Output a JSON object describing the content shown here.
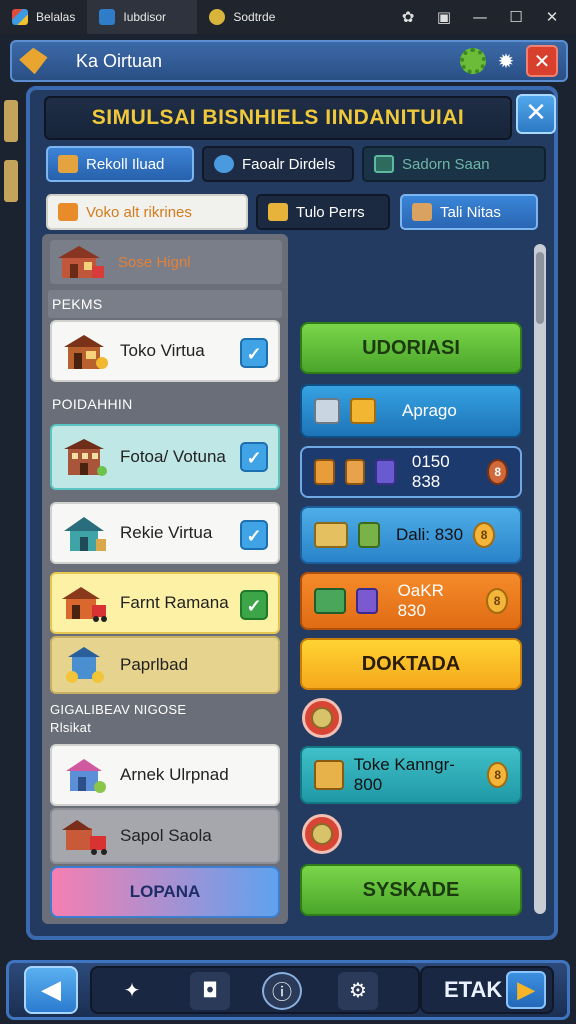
{
  "os_tabs": [
    {
      "label": "Belalas"
    },
    {
      "label": "Iubdisor"
    },
    {
      "label": "Sodtrde"
    }
  ],
  "app": {
    "title": "Ka Oirtuan"
  },
  "panel": {
    "title": "SIMULSAI BISNHIELS IINDANITUIAI"
  },
  "tabs_row1": [
    {
      "label": "Rekoll Iluad"
    },
    {
      "label": "Faoalr Dirdels"
    },
    {
      "label": "Sadorn Saan"
    }
  ],
  "tabs_row2": [
    {
      "label": "Voko alt rikrines"
    },
    {
      "label": "Tulo Perrs"
    },
    {
      "label": "Tali Nitas"
    }
  ],
  "left": {
    "header": "Sose Hignl",
    "sections": [
      {
        "label": "PEKMS"
      },
      {
        "label": "POIDAHHIN"
      },
      {
        "label": "GIGALIBEAV NIGOSE"
      },
      {
        "label": "Rlsikat"
      }
    ],
    "cards": [
      {
        "label": "Toko Virtua",
        "checked": true
      },
      {
        "label": "Fotoa/ Votuna",
        "checked": true
      },
      {
        "label": "Rekie Virtua",
        "checked": true
      },
      {
        "label": "Farnt Ramana",
        "checked": true
      },
      {
        "label": "Paprlbad",
        "checked": false
      },
      {
        "label": "Arnek Ulrpnad",
        "checked": false
      },
      {
        "label": "Sapol Saola",
        "checked": false
      }
    ],
    "bottom_button": "LOPANA"
  },
  "right": {
    "udoriasi": "UDORIASI",
    "row_aprago": "Aprago",
    "row_price1": "0150 838",
    "row_dali": "Dali: 830",
    "row_oakr": "OaKR 830",
    "doktada": "DOKTADA",
    "row_toko": "Toke Kanngr- 800",
    "syskade": "SYSKADE",
    "coin_glyph": "8"
  },
  "bottom_nav": {
    "next_label": "ETAK"
  },
  "colors": {
    "accent": "#3a6bb0",
    "title_gold": "#f0c93b",
    "primary_green": "#4aa62a",
    "orange": "#e06c14"
  }
}
